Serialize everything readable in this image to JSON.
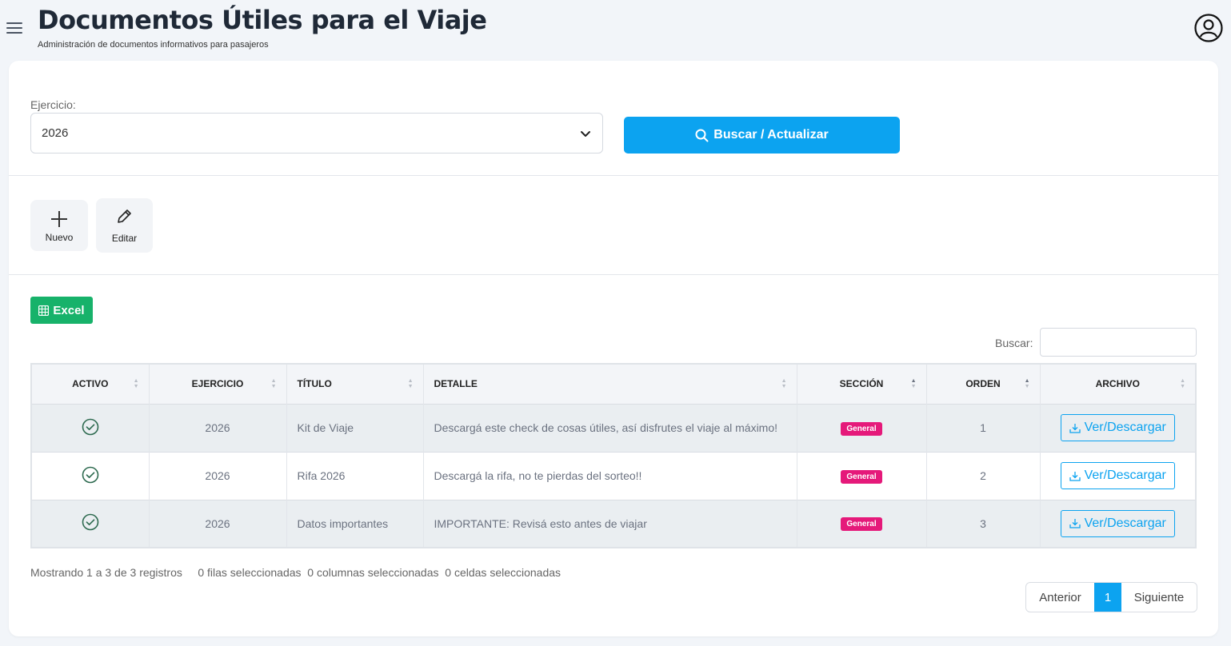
{
  "header": {
    "title": "Documentos Útiles para el Viaje",
    "subtitle": "Administración de documentos informativos para pasajeros"
  },
  "filter": {
    "label": "Ejercicio:",
    "selected": "2026",
    "search_button": "Buscar / Actualizar"
  },
  "toolbar": {
    "new_label": "Nuevo",
    "edit_label": "Editar"
  },
  "export": {
    "excel_label": "Excel"
  },
  "search": {
    "label": "Buscar:",
    "value": ""
  },
  "table": {
    "columns": [
      "ACTIVO",
      "EJERCICIO",
      "TÍTULO",
      "DETALLE",
      "SECCIÓN",
      "ORDEN",
      "ARCHIVO"
    ],
    "rows": [
      {
        "activo": true,
        "ejercicio": "2026",
        "titulo": "Kit de Viaje",
        "detalle": "Descargá este check de cosas útiles, así disfrutes el viaje al máximo!",
        "seccion": "General",
        "orden": "1",
        "archivo": "Ver/Descargar"
      },
      {
        "activo": true,
        "ejercicio": "2026",
        "titulo": "Rifa 2026",
        "detalle": "Descargá la rifa, no te pierdas del sorteo!!",
        "seccion": "General",
        "orden": "2",
        "archivo": "Ver/Descargar"
      },
      {
        "activo": true,
        "ejercicio": "2026",
        "titulo": "Datos importantes",
        "detalle": "IMPORTANTE: Revisá esto antes de viajar",
        "seccion": "General",
        "orden": "3",
        "archivo": "Ver/Descargar"
      }
    ]
  },
  "footer": {
    "info": "Mostrando 1 a 3 de 3 registros     0 filas seleccionadas  0 columnas seleccionadas  0 celdas seleccionadas",
    "prev": "Anterior",
    "page": "1",
    "next": "Siguiente"
  },
  "colors": {
    "primary": "#0ca3f0",
    "excel": "#17b26a",
    "badge": "#e5197a",
    "check": "#2d6a4f"
  }
}
